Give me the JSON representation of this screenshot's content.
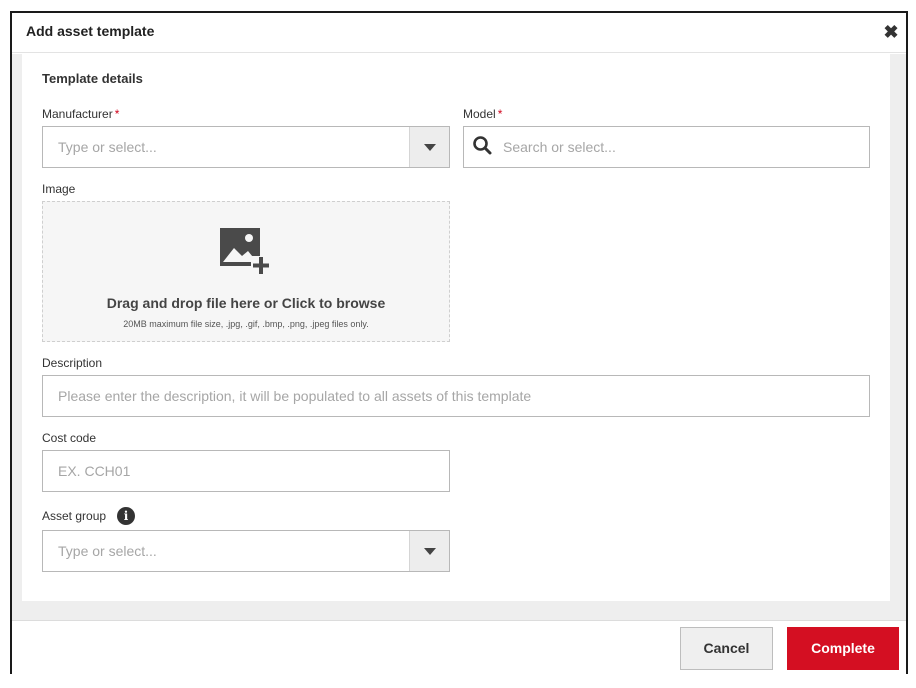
{
  "dialog": {
    "title": "Add asset template",
    "close_icon": "close-icon"
  },
  "form": {
    "section_title": "Template details",
    "manufacturer": {
      "label": "Manufacturer",
      "required_mark": "*",
      "placeholder": "Type or select..."
    },
    "model": {
      "label": "Model",
      "required_mark": "*",
      "placeholder": "Search or select...",
      "icon": "search-icon"
    },
    "image": {
      "label": "Image",
      "icon": "image-add-icon",
      "drop_text": "Drag and drop file here or Click to browse",
      "hint": "20MB maximum file size, .jpg, .gif, .bmp, .png, .jpeg files only."
    },
    "description": {
      "label": "Description",
      "placeholder": "Please enter the description, it will be populated to all assets of this template"
    },
    "cost_code": {
      "label": "Cost code",
      "placeholder": "EX. CCH01"
    },
    "asset_group": {
      "label": "Asset group",
      "info_icon": "info-icon",
      "info_glyph": "i",
      "placeholder": "Type or select..."
    }
  },
  "footer": {
    "cancel_label": "Cancel",
    "complete_label": "Complete"
  },
  "colors": {
    "accent": "#d40f22",
    "required": "#d0021b"
  }
}
